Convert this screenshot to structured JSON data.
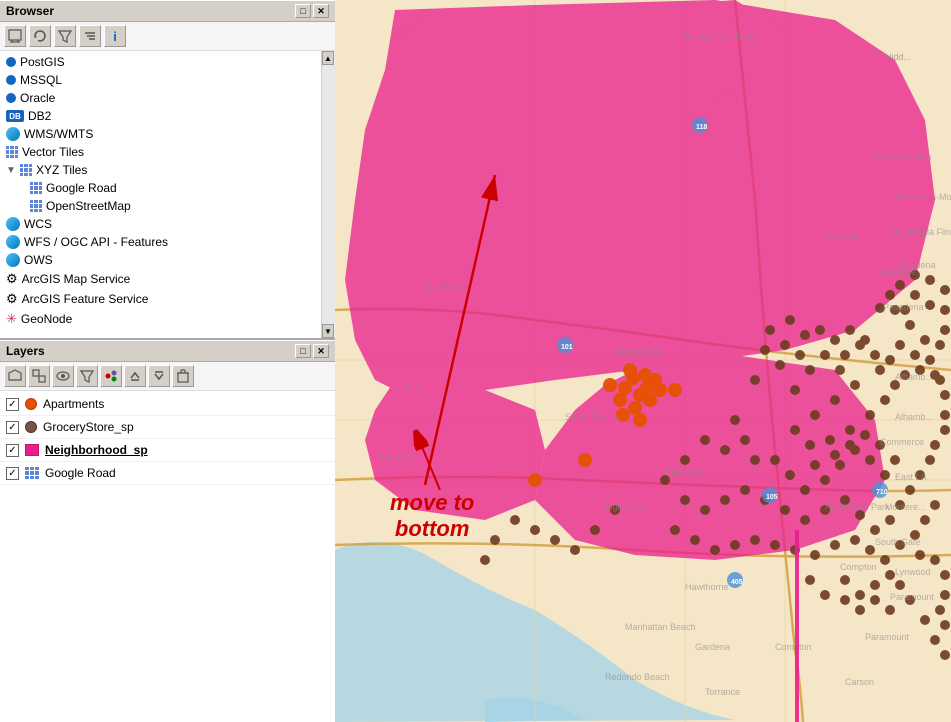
{
  "browser": {
    "title": "Browser",
    "toolbar_buttons": [
      "refresh-icon",
      "filter-icon",
      "up-icon",
      "info-icon"
    ],
    "items": [
      {
        "label": "PostGIS",
        "type": "dot-blue",
        "indent": 0
      },
      {
        "label": "MSSQL",
        "type": "dot-blue",
        "indent": 0
      },
      {
        "label": "Oracle",
        "type": "dot-blue",
        "indent": 0
      },
      {
        "label": "DB2",
        "type": "db2",
        "indent": 0
      },
      {
        "label": "WMS/WMTS",
        "type": "globe",
        "indent": 0
      },
      {
        "label": "Vector Tiles",
        "type": "grid-blue",
        "indent": 0
      },
      {
        "label": "XYZ Tiles",
        "type": "grid-blue",
        "indent": 0,
        "expanded": true
      },
      {
        "label": "Google Road",
        "type": "grid-blue",
        "indent": 1
      },
      {
        "label": "OpenStreetMap",
        "type": "grid-blue",
        "indent": 1
      },
      {
        "label": "WCS",
        "type": "globe",
        "indent": 0
      },
      {
        "label": "WFS / OGC API - Features",
        "type": "globe",
        "indent": 0
      },
      {
        "label": "OWS",
        "type": "globe",
        "indent": 0
      },
      {
        "label": "ArcGIS Map Service",
        "type": "gear",
        "indent": 0
      },
      {
        "label": "ArcGIS Feature Service",
        "type": "gear",
        "indent": 0
      },
      {
        "label": "GeoNode",
        "type": "snowflake",
        "indent": 0
      }
    ]
  },
  "layers": {
    "title": "Layers",
    "items": [
      {
        "label": "Apartments",
        "type": "dot-orange",
        "checked": true,
        "bold": false
      },
      {
        "label": "GroceryStore_sp",
        "type": "dot-brown",
        "checked": true,
        "bold": false
      },
      {
        "label": "Neighborhood_sp",
        "type": "square-pink",
        "checked": true,
        "bold": true,
        "underline": true
      },
      {
        "label": "Google Road",
        "type": "grid-blue",
        "checked": true,
        "bold": false
      }
    ]
  },
  "annotation": {
    "text": "move to\nbottom",
    "arrow_from_layer": "Google Road",
    "arrow_target": "Neighborhood label"
  },
  "map": {
    "background_land": "#f5e6c8",
    "neighborhood_fill": "#e91e8c",
    "neighborhood_opacity": 0.75,
    "ocean_color": "#a8d4e6",
    "road_color": "#d4a040"
  }
}
